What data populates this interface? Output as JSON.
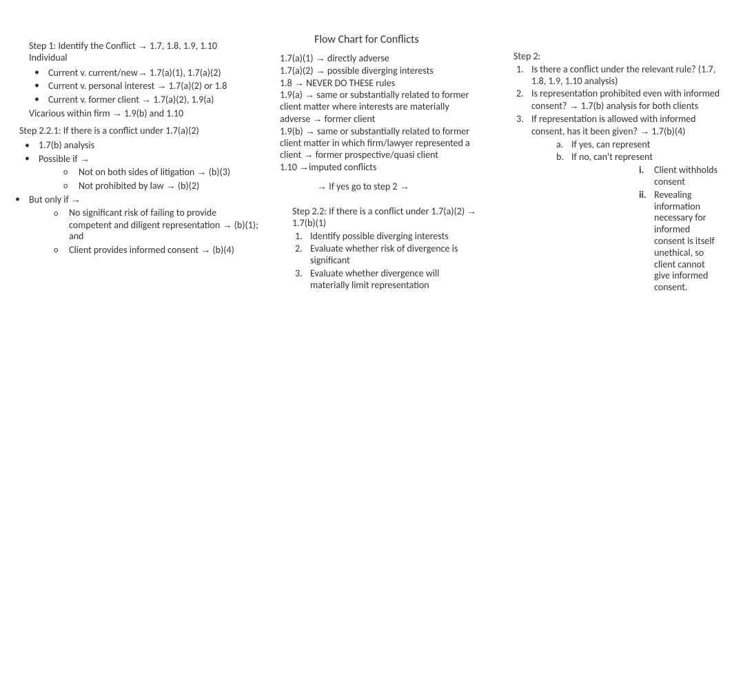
{
  "title": "Flow Chart for Conflicts",
  "arrow": "→",
  "box1": {
    "line1_pre": "Step 1: Identify the Conflict ",
    "line1_post": " 1.7, 1.8, 1.9, 1.10",
    "line2": "Individual",
    "bullets": [
      {
        "pre": "Current v. current/new",
        "post": " 1.7(a)(1), 1.7(a)(2)"
      },
      {
        "pre": "Current v. personal interest ",
        "post": " 1.7(a)(2) or 1.8"
      },
      {
        "pre": "Current v. former client ",
        "post": " 1.7(a)(2), 1.9(a)"
      }
    ],
    "line3_pre": "Vicarious within firm ",
    "line3_post": " 1.9(b) and 1.10"
  },
  "box2": {
    "lines": [
      {
        "pre": "1.7(a)(1) ",
        "post": " directly adverse"
      },
      {
        "pre": "1.7(a)(2) ",
        "post": " possible diverging interests"
      },
      {
        "pre": "1.8 ",
        "post": " NEVER DO THESE rules"
      },
      {
        "pre": "1.9(a) ",
        "post": " same or substantially related to former client matter where interests are materially adverse ",
        "post2": " former client"
      },
      {
        "pre": "1.9(b) ",
        "post": " same or substantially related to former client matter in which firm/lawyer represented a client ",
        "post2": " former prospective/quasi client"
      },
      {
        "pre": "1.10 ",
        "post": "imputed conflicts"
      }
    ],
    "center_pre": " If yes go to step 2 "
  },
  "box3": {
    "heading": "Step 2:",
    "items": [
      {
        "text": "Is there a conflict under the relevant rule? (1.7, 1.8, 1.9, 1.10 analysis)"
      },
      {
        "pre": "Is representation prohibited even with informed consent? ",
        "post": " 1.7(b) analysis for both clients"
      },
      {
        "pre": "If representation is allowed with informed consent, has it been given? ",
        "post": " 1.7(b)(4)"
      }
    ],
    "alpha": [
      "If yes, can represent",
      "If no, can't represent"
    ],
    "roman": [
      "Client withholds consent",
      "Revealing information necessary for informed consent is itself unethical, so client cannot give informed consent."
    ]
  },
  "box4": {
    "line1": "Step 2.2.1: If there is a conflict under 1.7(a)(2)",
    "b1": "1.7(b) analysis",
    "b2_pre": "Possible if ",
    "sub_possible": [
      {
        "pre": "Not on both sides of litigation ",
        "post": " (b)(3)"
      },
      {
        "pre": "Not prohibited by law ",
        "post": " (b)(2)"
      }
    ],
    "b3_pre": "But only if ",
    "sub_butonly": [
      {
        "pre": "No significant risk of failing to provide competent and diligent representation ",
        "post": " (b)(1); and"
      },
      {
        "pre": "Client provides informed consent ",
        "post": " (b)(4)"
      }
    ]
  },
  "box5": {
    "line1_pre": "Step 2.2: If there is a conflict under 1.7(a)(2) ",
    "line1_post": " 1.7(b)(1)",
    "items": [
      "Identify possible diverging interests",
      "Evaluate whether risk of divergence is significant",
      "Evaluate whether divergence will materially limit representation"
    ]
  }
}
